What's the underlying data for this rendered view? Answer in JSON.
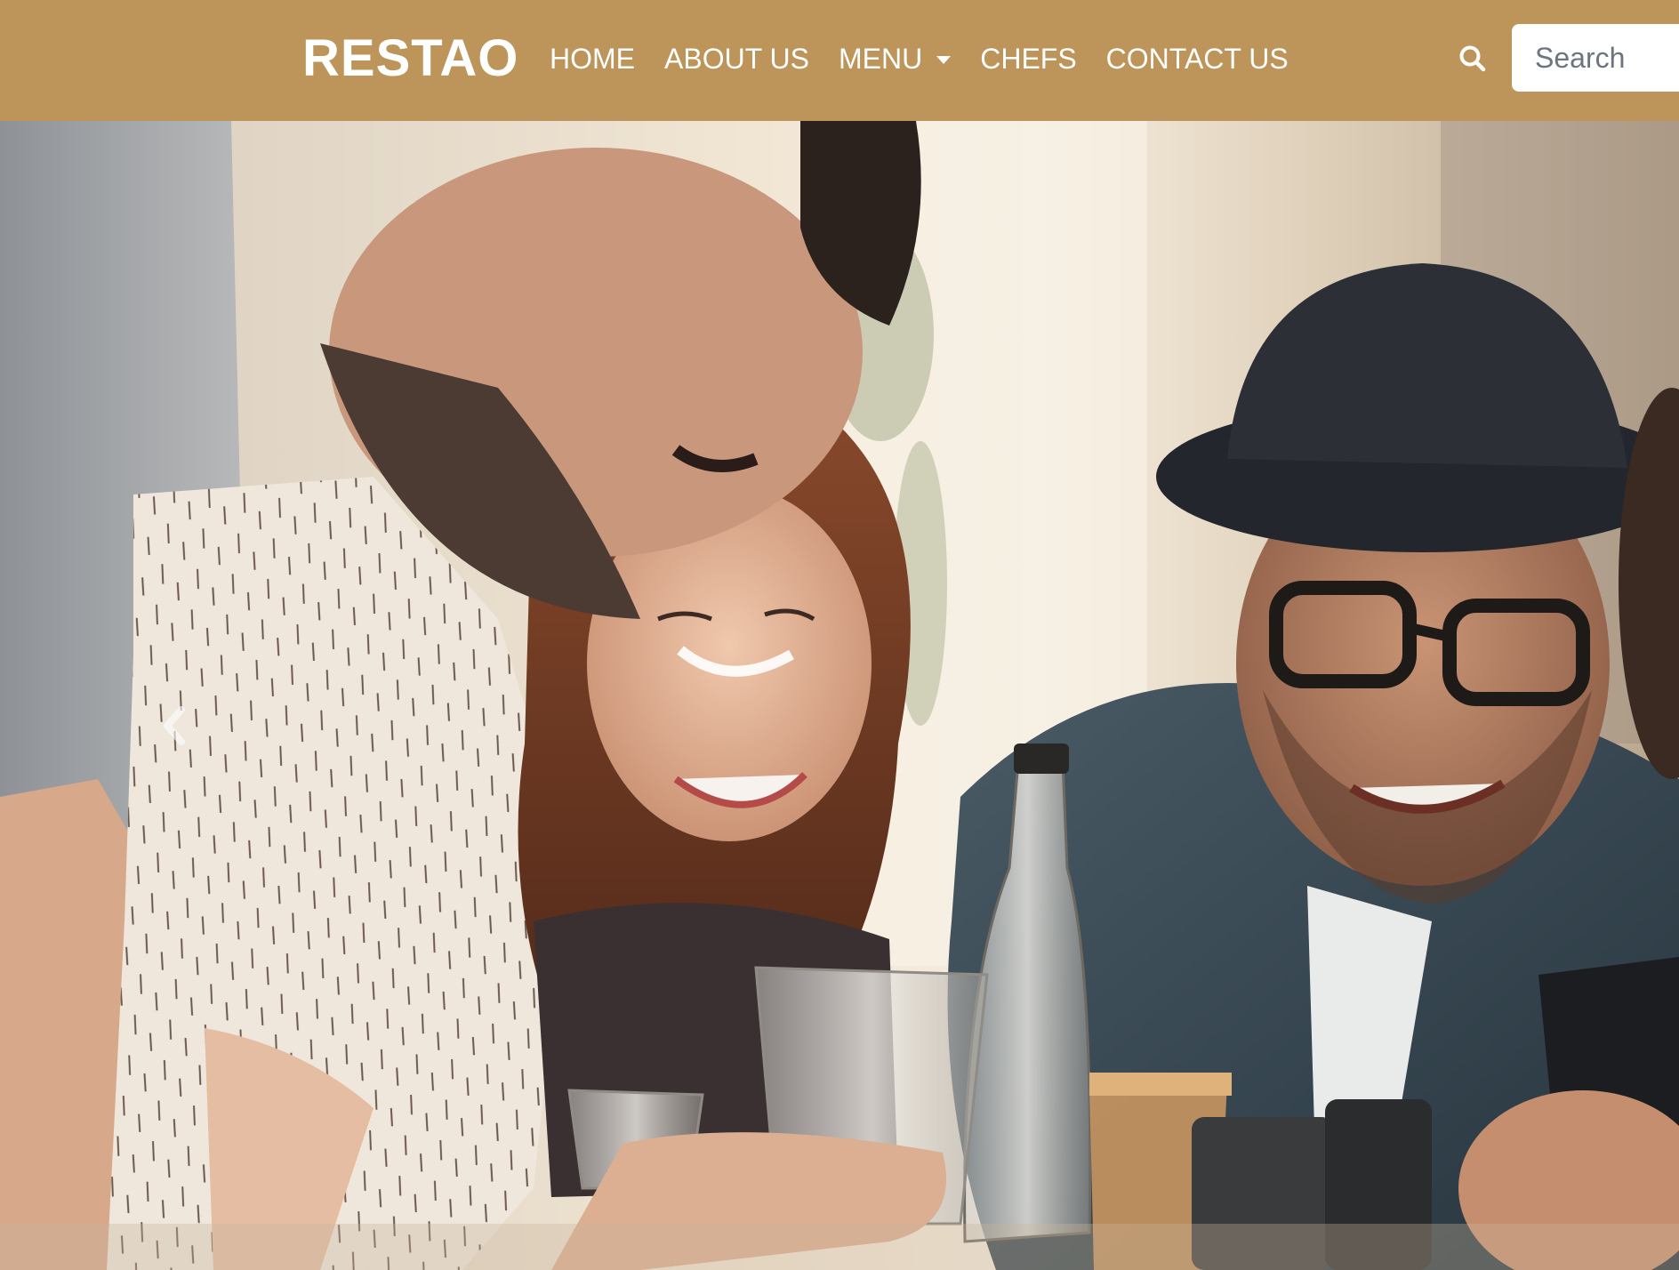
{
  "navbar": {
    "brand": "RESTAO",
    "links": [
      {
        "label": "HOME"
      },
      {
        "label": "ABOUT US"
      },
      {
        "label": "MENU",
        "has_dropdown": true
      },
      {
        "label": "CHEFS"
      },
      {
        "label": "CONTACT US"
      }
    ],
    "search": {
      "icon": "search-icon",
      "placeholder": "Search",
      "value": ""
    },
    "background_color": "#bd9459",
    "text_color": "#ffffff"
  },
  "hero": {
    "image_description_icon": "hero-photo",
    "controls": {
      "prev_icon": "chevron-left-icon"
    }
  }
}
